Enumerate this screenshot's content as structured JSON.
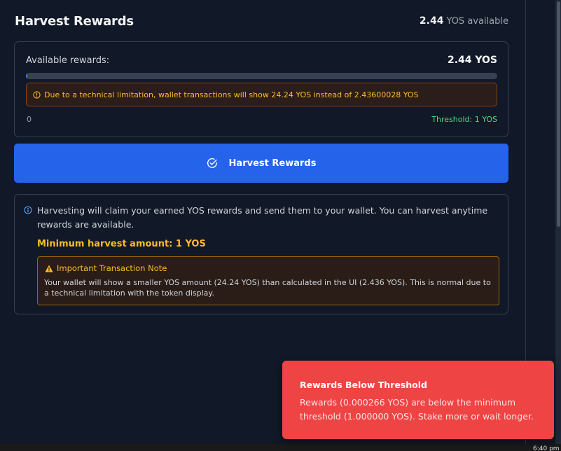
{
  "header": {
    "title": "Harvest Rewards",
    "available_amount": "2.44",
    "available_suffix": "YOS available"
  },
  "rewards_card": {
    "label": "Available rewards:",
    "value": "2.44 YOS",
    "progress_fraction": 0.003,
    "warning": "Due to a technical limitation, wallet transactions will show 24.24 YOS instead of 2.43600028 YOS",
    "scale_min": "0",
    "threshold": "Threshold: 1 YOS"
  },
  "harvest_button": {
    "label": "Harvest Rewards"
  },
  "info_card": {
    "text": "Harvesting will claim your earned YOS rewards and send them to your wallet. You can harvest anytime rewards are available.",
    "min_amount": "Minimum harvest amount: 1 YOS",
    "note_title": "Important Transaction Note",
    "note_body": "Your wallet will show a smaller YOS amount (24.24 YOS) than calculated in the UI (2.436 YOS). This is normal due to a technical limitation with the token display."
  },
  "toast": {
    "title": "Rewards Below Threshold",
    "body": "Rewards (0.000266 YOS) are below the minimum threshold (1.000000 YOS). Stake more or wait longer."
  },
  "taskbar": {
    "clock": "6:40 pm"
  },
  "colors": {
    "background": "#111827",
    "accent": "#2563eb",
    "warning": "#fbbf24",
    "success": "#4ade80",
    "toast": "#ef4444"
  },
  "icons": {
    "warning": "alert-circle-icon",
    "harvest": "check-circle-icon",
    "info": "info-icon",
    "note": "warning-triangle-icon"
  }
}
